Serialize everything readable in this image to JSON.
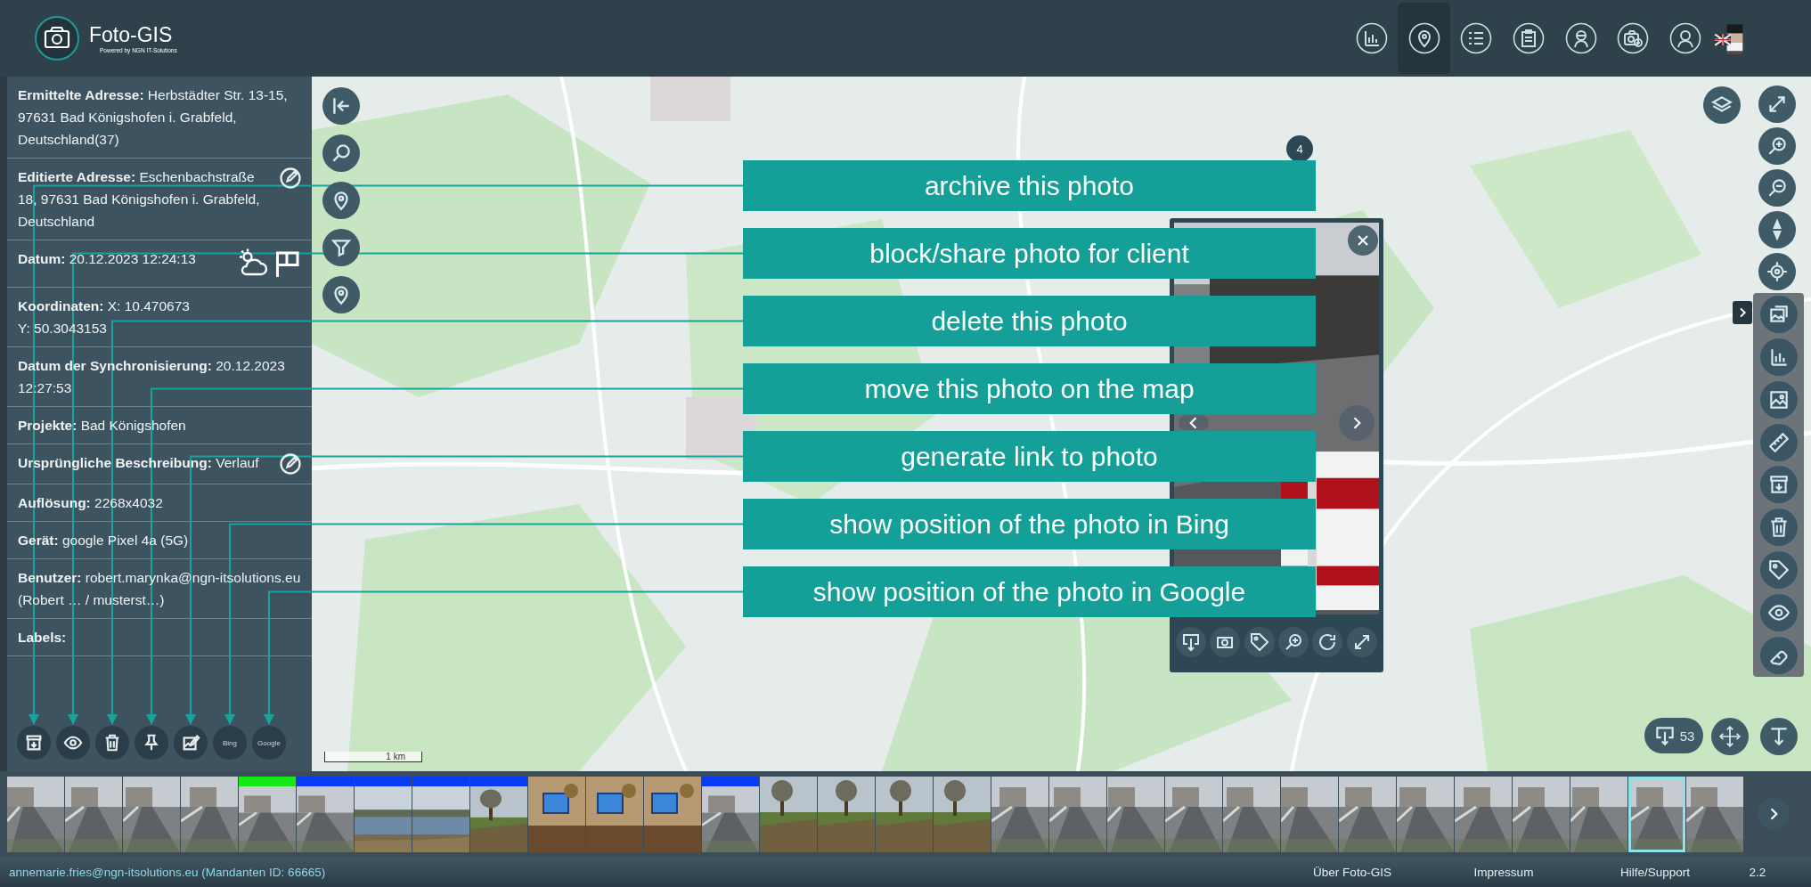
{
  "header": {
    "title": "Foto-GIS",
    "subtitle": "Powered by NGN IT-Solutions",
    "nav": [
      {
        "selected": false
      },
      {
        "selected": true
      },
      {
        "selected": false
      },
      {
        "selected": false
      },
      {
        "selected": false
      },
      {
        "selected": false
      },
      {
        "selected": false
      }
    ]
  },
  "details": [
    {
      "kind": "text",
      "lines": [
        "**Ermittelte Adresse:** Herbstädter Str. 13-15, 97631 Bad Königshofen i. Grabfeld, Deutschland(37)"
      ]
    },
    {
      "kind": "editable",
      "lines": [
        "**Editierte Adresse:** Eschenbachstraße 18, 97631 Bad Königshofen i. Grabfeld, Deutschland"
      ]
    },
    {
      "kind": "weather",
      "lines": [
        "**Datum:** 20.12.2023 12:24:13"
      ]
    },
    {
      "kind": "text",
      "lines": [
        "**Koordinaten:** X: 10.470673",
        "Y: 50.3043153"
      ]
    },
    {
      "kind": "text",
      "lines": [
        "**Datum der Synchronisierung:** 20.12.2023 12:27:53"
      ]
    },
    {
      "kind": "text",
      "lines": [
        "**Projekte:** Bad Königshofen"
      ]
    },
    {
      "kind": "editable",
      "lines": [
        "**Ursprüngliche Beschreibung:** Verlauf"
      ]
    },
    {
      "kind": "text",
      "lines": [
        "**Auflösung:** 2268x4032"
      ]
    },
    {
      "kind": "text",
      "lines": [
        "**Gerät:** google Pixel 4a (5G)"
      ]
    },
    {
      "kind": "text",
      "lines": [
        "**Benutzer:** robert.marynka@ngn-itsolutions.eu",
        "(Robert … / musterst…)"
      ]
    },
    {
      "kind": "text",
      "lines": [
        "**Labels:**"
      ]
    }
  ],
  "detail_actions": [
    "Bing",
    "Google"
  ],
  "callouts": [
    "archive this photo",
    "block/share photo for client",
    "delete this photo",
    "move this photo on the map",
    "generate link to photo",
    "show position of the photo in Bing",
    "show position of the photo in Google"
  ],
  "map": {
    "cluster": "4",
    "scale": "1 km",
    "photo_count": "53"
  },
  "thumbnails": [
    {
      "selected": false
    },
    {
      "selected": false
    },
    {
      "selected": false
    },
    {
      "selected": false
    },
    {
      "selected": false,
      "color": "#18e818"
    },
    {
      "selected": false,
      "color": "#0a3cf5"
    },
    {
      "selected": false,
      "color": "#0a3cf5"
    },
    {
      "selected": false,
      "color": "#0a3cf5"
    },
    {
      "selected": false,
      "color": "#0a3cf5"
    },
    {
      "selected": false
    },
    {
      "selected": false
    },
    {
      "selected": false
    },
    {
      "selected": false,
      "color": "#0a3cf5"
    },
    {
      "selected": false
    },
    {
      "selected": false
    },
    {
      "selected": false
    },
    {
      "selected": false
    },
    {
      "selected": false
    },
    {
      "selected": false
    },
    {
      "selected": false
    },
    {
      "selected": false
    },
    {
      "selected": false
    },
    {
      "selected": false
    },
    {
      "selected": false
    },
    {
      "selected": false
    },
    {
      "selected": false
    },
    {
      "selected": false
    },
    {
      "selected": false
    },
    {
      "selected": true
    },
    {
      "selected": false
    }
  ],
  "status_bar": {
    "user": "annemarie.fries@ngn-itsolutions.eu (Mandanten ID: 66665)",
    "links": [
      "Über Foto-GIS",
      "Impressum",
      "Hilfe/Support"
    ],
    "version": "2.2"
  }
}
